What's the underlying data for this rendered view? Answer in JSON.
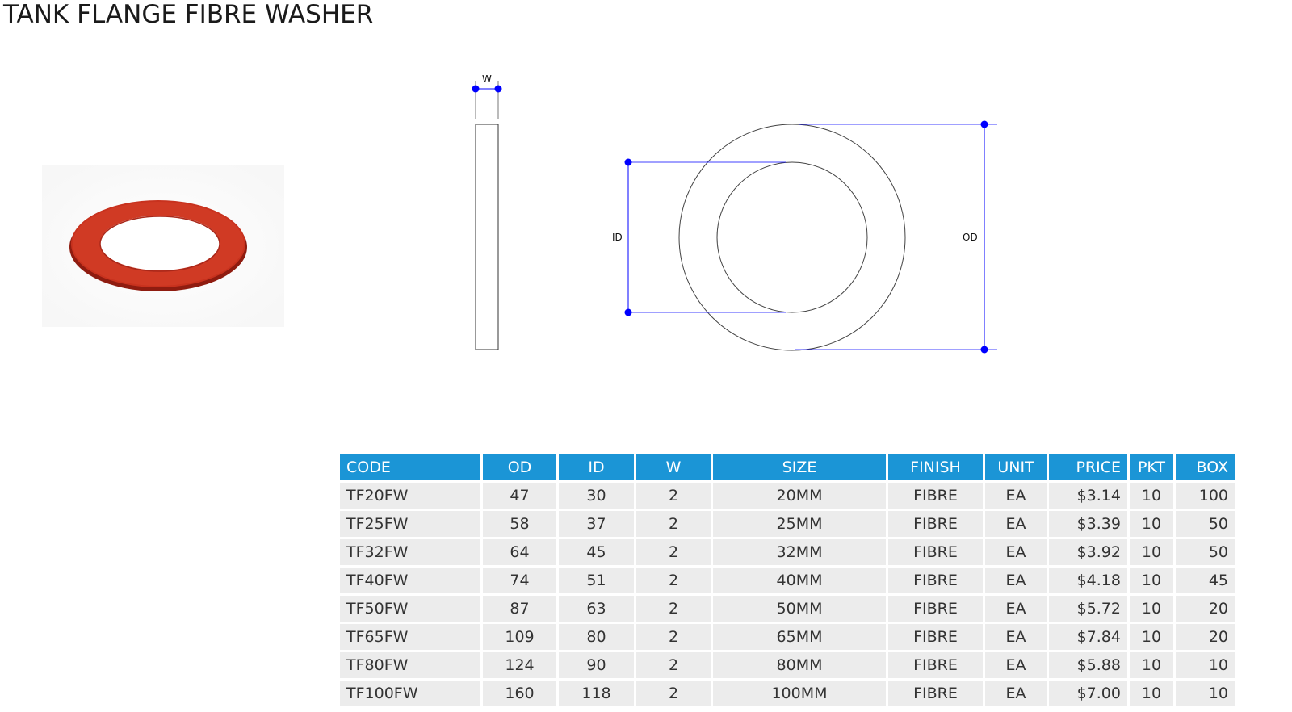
{
  "title": "TANK FLANGE FIBRE WASHER",
  "colors": {
    "header_bg": "#1b95d6",
    "row_bg": "#ececec",
    "washer": "#c8301c",
    "dimension_line": "#0000ff"
  },
  "image": {
    "icon": "red-fibre-washer-photo"
  },
  "diagram": {
    "w_label": "W",
    "id_label": "ID",
    "od_label": "OD"
  },
  "table": {
    "headers": [
      "CODE",
      "OD",
      "ID",
      "W",
      "SIZE",
      "FINISH",
      "UNIT",
      "PRICE",
      "PKT",
      "BOX"
    ],
    "rows": [
      [
        "TF20FW",
        "47",
        "30",
        "2",
        "20MM",
        "FIBRE",
        "EA",
        "$3.14",
        "10",
        "100"
      ],
      [
        "TF25FW",
        "58",
        "37",
        "2",
        "25MM",
        "FIBRE",
        "EA",
        "$3.39",
        "10",
        "50"
      ],
      [
        "TF32FW",
        "64",
        "45",
        "2",
        "32MM",
        "FIBRE",
        "EA",
        "$3.92",
        "10",
        "50"
      ],
      [
        "TF40FW",
        "74",
        "51",
        "2",
        "40MM",
        "FIBRE",
        "EA",
        "$4.18",
        "10",
        "45"
      ],
      [
        "TF50FW",
        "87",
        "63",
        "2",
        "50MM",
        "FIBRE",
        "EA",
        "$5.72",
        "10",
        "20"
      ],
      [
        "TF65FW",
        "109",
        "80",
        "2",
        "65MM",
        "FIBRE",
        "EA",
        "$7.84",
        "10",
        "20"
      ],
      [
        "TF80FW",
        "124",
        "90",
        "2",
        "80MM",
        "FIBRE",
        "EA",
        "$5.88",
        "10",
        "10"
      ],
      [
        "TF100FW",
        "160",
        "118",
        "2",
        "100MM",
        "FIBRE",
        "EA",
        "$7.00",
        "10",
        "10"
      ]
    ]
  }
}
